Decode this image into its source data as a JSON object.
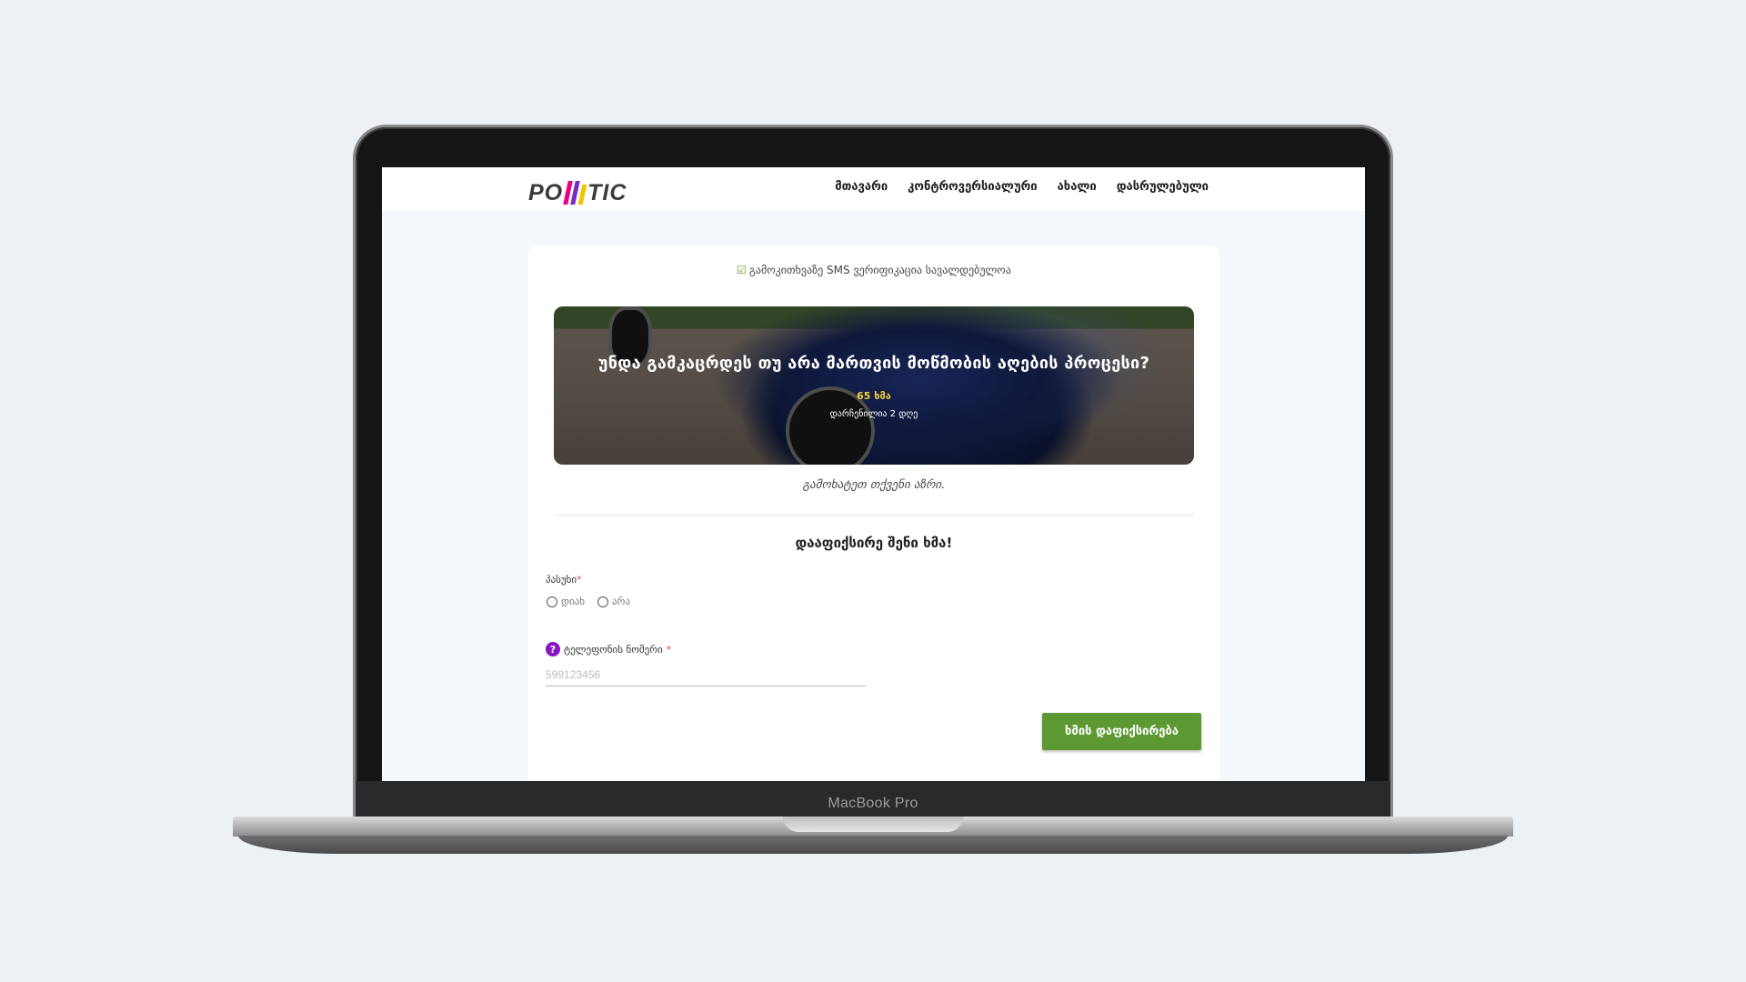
{
  "device": {
    "label": "MacBook Pro"
  },
  "logo": {
    "prefix": "PO",
    "suffix": "TIC",
    "bar_colors": [
      "#e6007e",
      "#7b2cbf",
      "#f5c400"
    ]
  },
  "nav": {
    "items": [
      {
        "label": "მთავარი"
      },
      {
        "label": "კონტროვერსიალური"
      },
      {
        "label": "ახალი"
      },
      {
        "label": "დასრულებული"
      }
    ]
  },
  "poll": {
    "sms_note": "გამოკითხვაზე SMS ვერიფიკაცია სავალდებულოა",
    "title": "უნდა გამკაცრდეს თუ არა მართვის მოწმობის აღების პროცესი?",
    "votes": "65 ხმა",
    "time_left": "დარჩენილია 2 დღე",
    "prompt": "გამოხატეთ თქვენი აზრი."
  },
  "form": {
    "title": "დააფიქსირე შენი ხმა!",
    "answer_label": "პასუხი",
    "required_mark": "*",
    "options": [
      {
        "label": "დიახ"
      },
      {
        "label": "არა"
      }
    ],
    "phone_label": "ტელეფონის ნომერი",
    "phone_placeholder": "599123456",
    "phone_value": "",
    "submit_label": "ხმის დაფიქსირება"
  },
  "colors": {
    "accent_green": "#5c9932",
    "help_purple": "#8a14c8",
    "votes_yellow": "#f3d23a",
    "required_red": "#d9534f"
  },
  "icons": {
    "sms_check": "check-square-icon",
    "help": "question-circle-icon"
  }
}
